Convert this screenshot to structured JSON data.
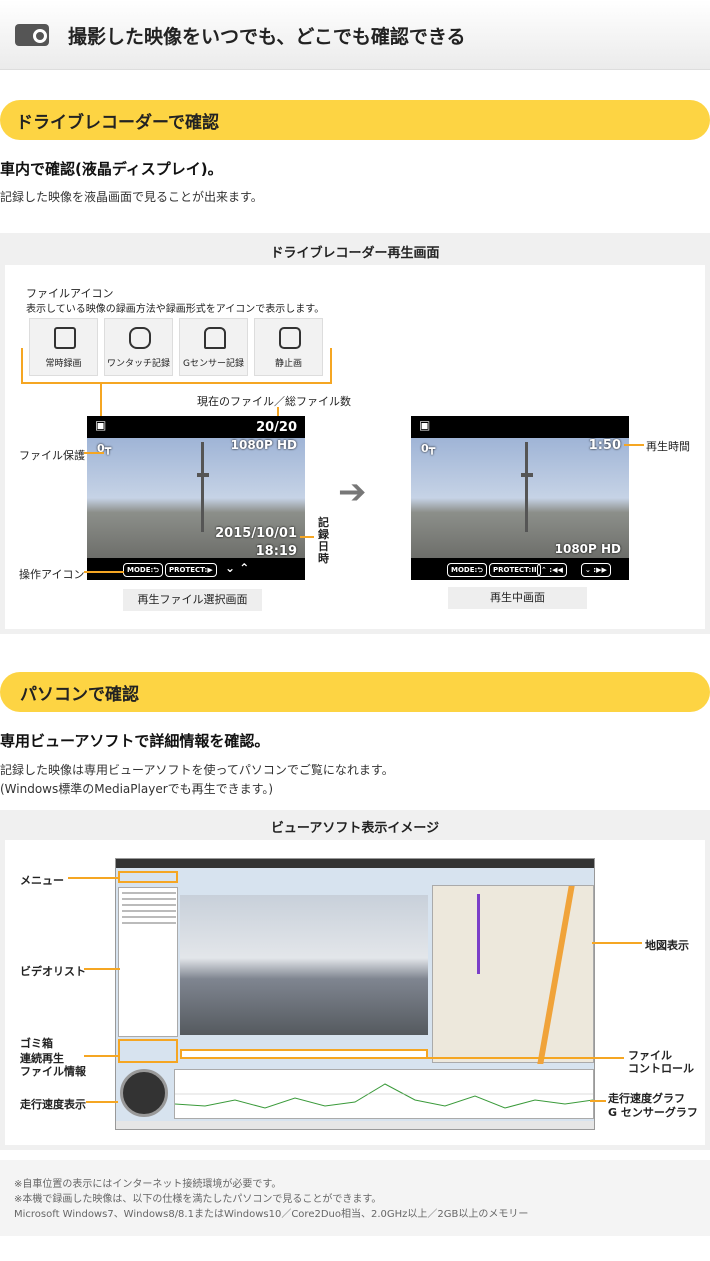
{
  "header": {
    "title": "撮影した映像をいつでも、どこでも確認できる",
    "icon": "camera-icon"
  },
  "section1": {
    "banner": "ドライブレコーダーで確認",
    "subhead": "車内で確認(液晶ディスプレイ)。",
    "body": "記録した映像を液晶画面で見ることが出来ます。",
    "panel_title": "ドライブレコーダー再生画面",
    "file_icon_label": "ファイルアイコン",
    "file_icon_desc": "表示している映像の録画方法や録画形式をアイコンで表示します。",
    "icons": [
      {
        "label": "常時録画",
        "icon": "film-icon"
      },
      {
        "label": "ワンタッチ記録",
        "icon": "lock-hand-icon"
      },
      {
        "label": "Gセンサー記録",
        "icon": "car-crash-icon"
      },
      {
        "label": "静止画",
        "icon": "camera-icon"
      }
    ],
    "current_total_label": "現在のファイル／総ファイル数",
    "file_protect_label": "ファイル保護",
    "op_icon_label": "操作アイコン",
    "record_datetime_label": "記録日時",
    "play_time_label": "再生時間",
    "screen1": {
      "counter": "20/20",
      "resolution": "1080P HD",
      "date": "2015/10/01",
      "time": "18:19",
      "btn_mode": "MODE:⮌",
      "btn_protect": "PROTECT:▶",
      "arrows": "⌄ ⌃",
      "caption": "再生ファイル選択画面"
    },
    "screen2": {
      "play_time": "1:50",
      "resolution": "1080P HD",
      "btn_mode": "MODE:⮌",
      "btn_protect": "PROTECT:II",
      "btn_up": "⌃ :◀◀",
      "btn_down": "⌄ :▶▶",
      "caption": "再生中画面"
    }
  },
  "section2": {
    "banner": "パソコンで確認",
    "subhead": "専用ビューアソフトで詳細情報を確認。",
    "body1": "記録した映像は専用ビューアソフトを使ってパソコンでご覧になれます。",
    "body2": "(Windows標準のMediaPlayerでも再生できます。)",
    "panel_title": "ビューアソフト表示イメージ",
    "labels": {
      "menu": "メニュー",
      "video_list": "ビデオリスト",
      "trash1": "ゴミ箱",
      "trash2": "連続再生",
      "trash3": "ファイル情報",
      "speed_display": "走行速度表示",
      "map_display": "地図表示",
      "file_ctrl1": "ファイル",
      "file_ctrl2": "コントロール",
      "graph1": "走行速度グラフ",
      "graph2": "G センサーグラフ"
    }
  },
  "notes": [
    "※自車位置の表示にはインターネット接続環境が必要です。",
    "※本機で録画した映像は、以下の仕様を満たしたパソコンで見ることができます。",
    "Microsoft Windows7、Windows8/8.1またはWindows10／Core2Duo相当、2.0GHz以上／2GB以上のメモリー"
  ],
  "colors": {
    "accent": "#fdd443",
    "line": "#f5a623"
  }
}
